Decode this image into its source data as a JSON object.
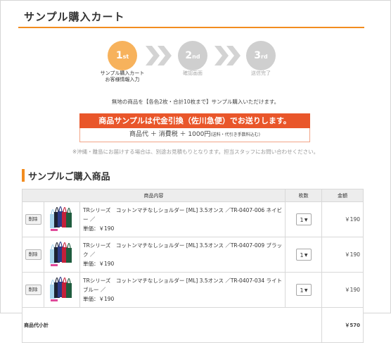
{
  "page": {
    "title": "サンプル購入カート"
  },
  "steps": [
    {
      "num": "1",
      "suffix": "st",
      "label_lines": [
        "サンプル購入カート",
        "お客様情報入力"
      ],
      "active": true
    },
    {
      "num": "2",
      "suffix": "nd",
      "label_lines": [
        "確認画面"
      ],
      "active": false
    },
    {
      "num": "3",
      "suffix": "rd",
      "label_lines": [
        "送信完了"
      ],
      "active": false
    }
  ],
  "notice": "無地の商品を【各色2枚・合計10枚まで】サンプル購入いただけます。",
  "cod": {
    "banner": "商品サンプルは代金引換（佐川急便）でお送りします。",
    "price_line": "商品代 ＋ 消費税 ＋ 1000円",
    "price_note": "(送料・代引き手数料込む)"
  },
  "rural_note": "※沖縄・離島にお届けする場合は、別途お見積もりとなります。担当スタッフにお問い合わせください。",
  "section": {
    "title": "サンプルご購入商品"
  },
  "table": {
    "headers": {
      "content": "商品内容",
      "qty": "枚数",
      "amount": "金額"
    },
    "delete_label": "削除",
    "rows": [
      {
        "name": "TRシリーズ　コットンマチなしショルダー [ML] 3.5オンス ／TR-0407-006 ネイビー ／",
        "unit_price": "単価：￥190",
        "qty": "1",
        "amount": "￥190"
      },
      {
        "name": "TRシリーズ　コットンマチなしショルダー [ML] 3.5オンス ／TR-0407-009 ブラック ／",
        "unit_price": "単価：￥190",
        "qty": "1",
        "amount": "￥190"
      },
      {
        "name": "TRシリーズ　コットンマチなしショルダー [ML] 3.5オンス ／TR-0407-034 ライトブルー ／",
        "unit_price": "単価：￥190",
        "qty": "1",
        "amount": "￥190"
      }
    ],
    "subtotal_label": "商品代小計",
    "subtotal_value": "￥570"
  },
  "colors": {
    "accent_orange": "#f28c1f",
    "step_active": "#f7b25c",
    "step_inactive": "#cfcfcf",
    "banner_red": "#e9562a",
    "bag_colors": [
      "#a7d4ec",
      "#1c2333",
      "#2b3a86",
      "#c4203a",
      "#1f5c3e",
      "#e04a9a"
    ]
  }
}
